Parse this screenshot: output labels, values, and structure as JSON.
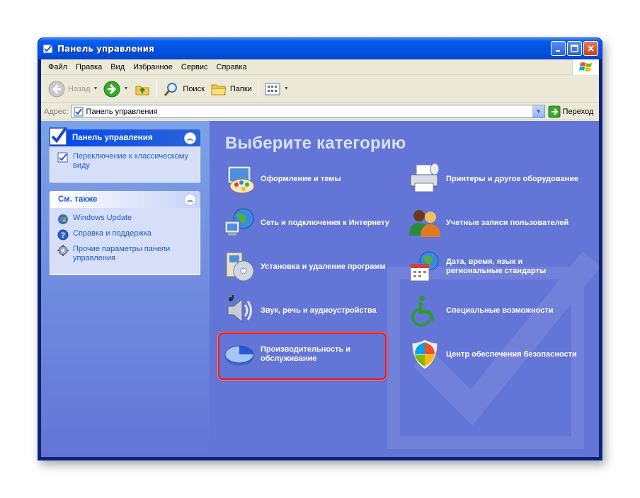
{
  "window": {
    "title": "Панель управления"
  },
  "menu": {
    "file": "Файл",
    "edit": "Правка",
    "view": "Вид",
    "favorites": "Избранное",
    "tools": "Сервис",
    "help": "Справка"
  },
  "toolbar": {
    "back": "Назад",
    "search": "Поиск",
    "folders": "Папки"
  },
  "address": {
    "label": "Адрес:",
    "value": "Панель управления",
    "go": "Переход"
  },
  "sidebar": {
    "main_panel": {
      "title": "Панель управления",
      "switch_link": "Переключение к классическому виду"
    },
    "see_also": {
      "title": "См. также",
      "items": [
        {
          "label": "Windows Update",
          "icon": "windows-update-icon"
        },
        {
          "label": "Справка и поддержка",
          "icon": "help-icon"
        },
        {
          "label": "Прочие параметры панели управления",
          "icon": "gear-icon"
        }
      ]
    }
  },
  "main": {
    "heading": "Выберите категорию",
    "categories": [
      {
        "label": "Оформление и темы",
        "icon": "appearance-icon"
      },
      {
        "label": "Принтеры и другое оборудование",
        "icon": "printer-icon"
      },
      {
        "label": "Сеть и подключения к Интернету",
        "icon": "network-icon"
      },
      {
        "label": "Учетные записи пользователей",
        "icon": "users-icon"
      },
      {
        "label": "Установка и удаление программ",
        "icon": "add-remove-icon"
      },
      {
        "label": "Дата, время, язык и региональные стандарты",
        "icon": "datetime-icon"
      },
      {
        "label": "Звук, речь и аудиоустройства",
        "icon": "sound-icon"
      },
      {
        "label": "Специальные возможности",
        "icon": "accessibility-icon"
      },
      {
        "label": "Производительность и обслуживание",
        "icon": "performance-icon",
        "highlighted": true
      },
      {
        "label": "Центр обеспечения безопасности",
        "icon": "security-shield-icon"
      }
    ]
  },
  "colors": {
    "titlebar": "#0054e3",
    "content_bg": "#6375d6",
    "link": "#215dc6",
    "highlight": "#e02020"
  }
}
